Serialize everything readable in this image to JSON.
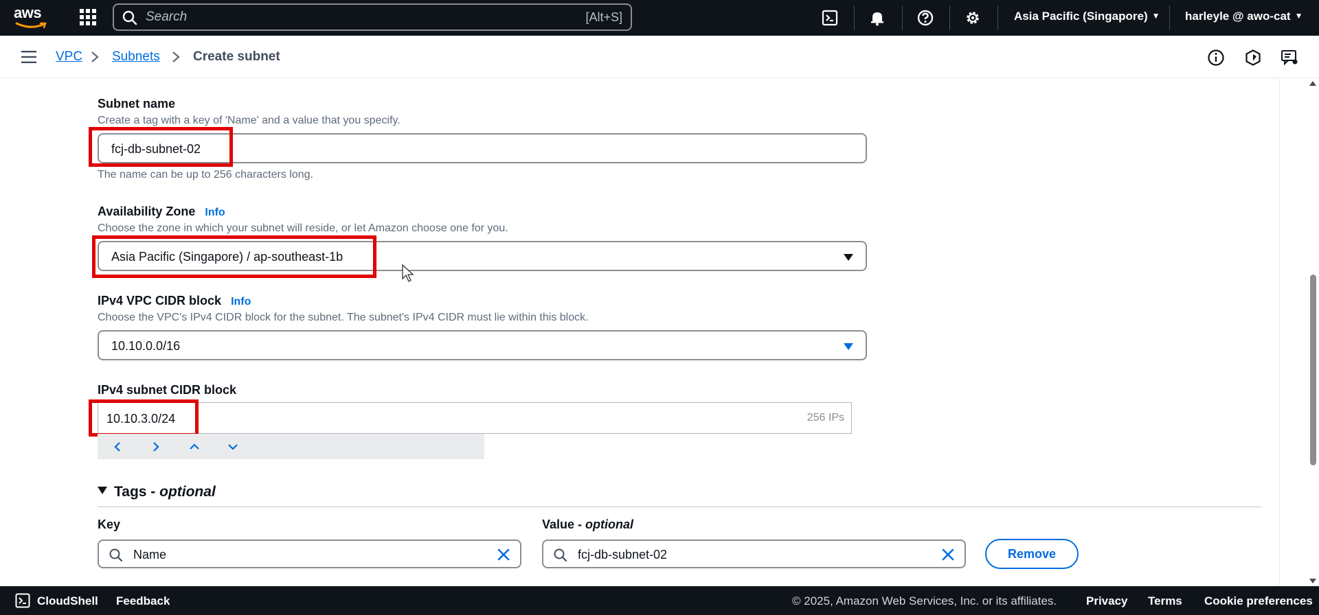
{
  "topnav": {
    "logo_text": "aws",
    "search_placeholder": "Search",
    "search_shortcut": "[Alt+S]",
    "region": "Asia Pacific (Singapore)",
    "account": "harleyle @ awo-cat"
  },
  "breadcrumb": {
    "items": [
      "VPC",
      "Subnets"
    ],
    "current": "Create subnet"
  },
  "form": {
    "subnet_name": {
      "label": "Subnet name",
      "description": "Create a tag with a key of 'Name' and a value that you specify.",
      "value": "fcj-db-subnet-02",
      "hint": "The name can be up to 256 characters long."
    },
    "availability_zone": {
      "label": "Availability Zone",
      "info": "Info",
      "description": "Choose the zone in which your subnet will reside, or let Amazon choose one for you.",
      "value": "Asia Pacific (Singapore) / ap-southeast-1b"
    },
    "vpc_cidr": {
      "label": "IPv4 VPC CIDR block",
      "info": "Info",
      "description": "Choose the VPC's IPv4 CIDR block for the subnet. The subnet's IPv4 CIDR must lie within this block.",
      "value": "10.10.0.0/16"
    },
    "subnet_cidr": {
      "label": "IPv4 subnet CIDR block",
      "value": "10.10.3.0/24",
      "ip_count": "256 IPs"
    },
    "tags": {
      "heading": "Tags - ",
      "heading_optional": "optional",
      "key_label": "Key",
      "value_label": "Value - ",
      "value_optional": "optional",
      "key": "Name",
      "value": "fcj-db-subnet-02",
      "remove_label": "Remove"
    }
  },
  "footer": {
    "cloudshell": "CloudShell",
    "feedback": "Feedback",
    "copyright": "© 2025, Amazon Web Services, Inc. or its affiliates.",
    "privacy": "Privacy",
    "terms": "Terms",
    "cookies": "Cookie preferences"
  },
  "colors": {
    "nav_bg": "#0f141a",
    "link": "#006ce0",
    "highlight": "#e00000"
  }
}
